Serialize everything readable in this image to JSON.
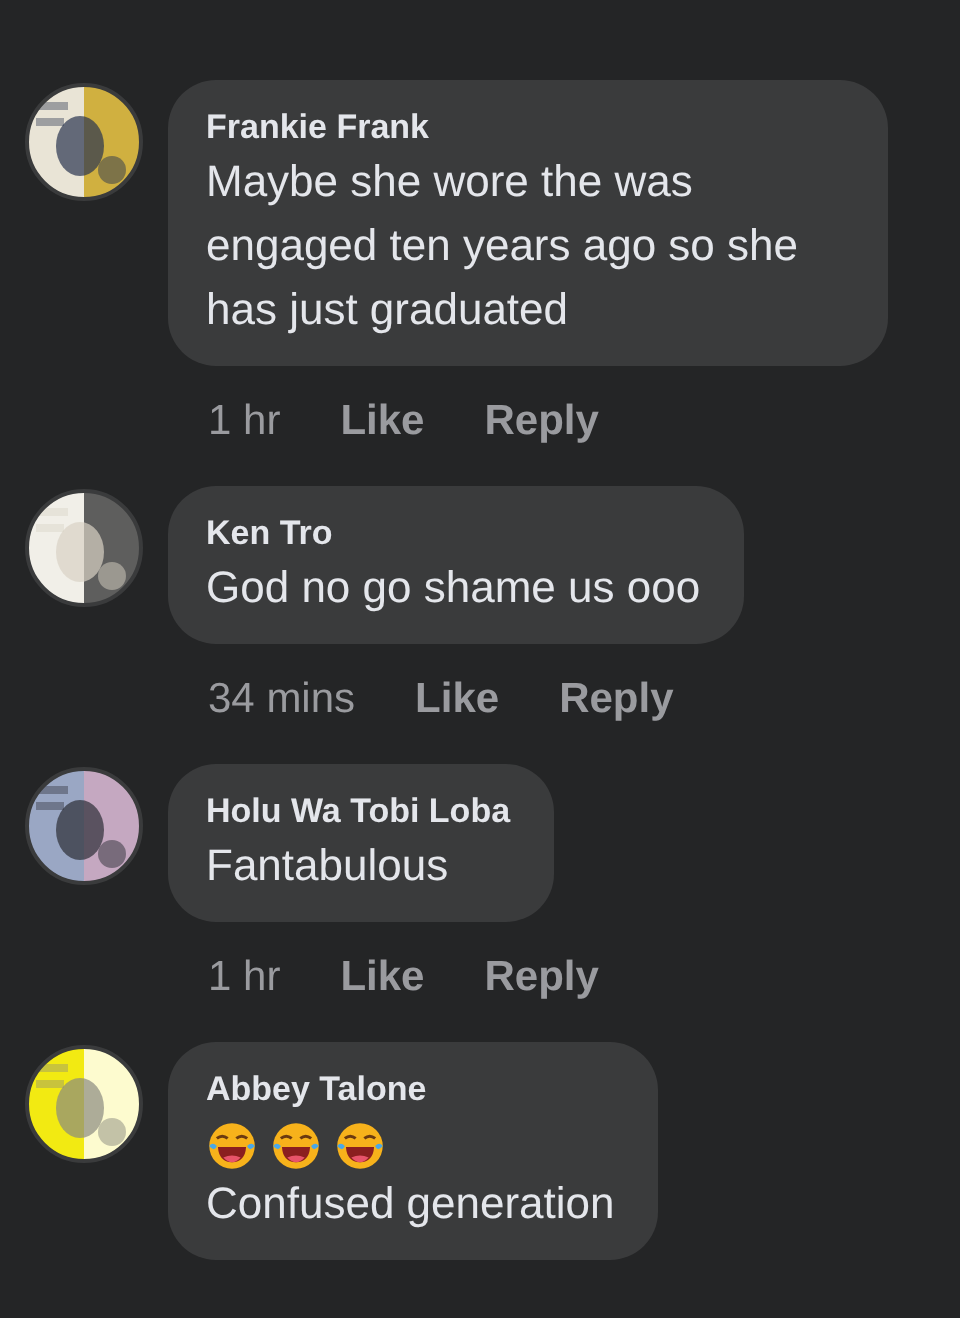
{
  "comments": [
    {
      "author": "Frankie Frank",
      "text": "Maybe she wore the was engaged ten years ago so she has just graduated",
      "time": "1 hr",
      "actions": [
        "Like",
        "Reply"
      ]
    },
    {
      "author": "Ken Tro",
      "text": "God no go shame us ooo",
      "time": "34 mins",
      "actions": [
        "Like",
        "Reply"
      ]
    },
    {
      "author": "Holu Wa Tobi Loba",
      "text": "Fantabulous",
      "time": "1 hr",
      "actions": [
        "Like",
        "Reply"
      ]
    },
    {
      "author": "Abbey Talone",
      "emojis": [
        {
          "kind": "laughing"
        },
        {
          "kind": "laughing"
        },
        {
          "kind": "laughing"
        }
      ],
      "text": "Confused generation"
    }
  ]
}
